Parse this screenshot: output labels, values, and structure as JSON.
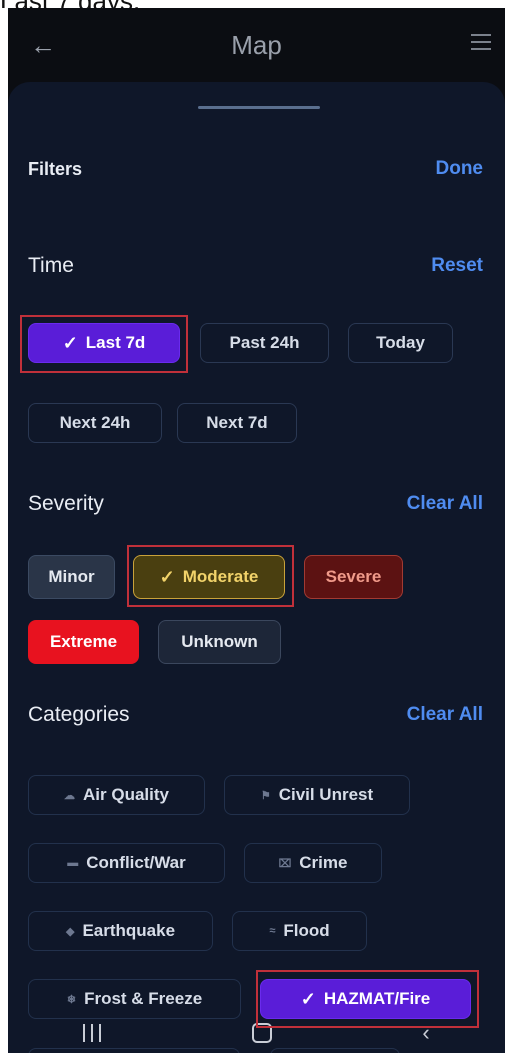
{
  "caption_text": "Last 7 days.",
  "app": {
    "title": "Map"
  },
  "filters": {
    "title": "Filters",
    "done_label": "Done"
  },
  "time": {
    "title": "Time",
    "reset_label": "Reset",
    "chips": [
      "Last 7d",
      "Past 24h",
      "Today",
      "Next 24h",
      "Next 7d"
    ],
    "selected": "Last 7d"
  },
  "severity": {
    "title": "Severity",
    "clear_label": "Clear All",
    "chips": [
      "Minor",
      "Moderate",
      "Severe",
      "Extreme",
      "Unknown"
    ],
    "selected": "Moderate"
  },
  "categories": {
    "title": "Categories",
    "clear_label": "Clear All",
    "chips": [
      "Air Quality",
      "Civil Unrest",
      "Conflict/War",
      "Crime",
      "Earthquake",
      "Flood",
      "Frost & Freeze",
      "HAZMAT/Fire"
    ],
    "icons": [
      "air-icon",
      "protest-icon",
      "conflict-icon",
      "crime-icon",
      "earthquake-icon",
      "flood-icon",
      "frost-icon"
    ],
    "selected": "HAZMAT/Fire"
  },
  "colors": {
    "background": "#0f1729",
    "accent_blue": "#4f8cf0",
    "selected_purple": "#5a1dd8",
    "moderate_gold": "#f2d36a",
    "severe_red": "#5c1212",
    "extreme_red": "#e8121f",
    "annotation_red": "#c0303a"
  }
}
